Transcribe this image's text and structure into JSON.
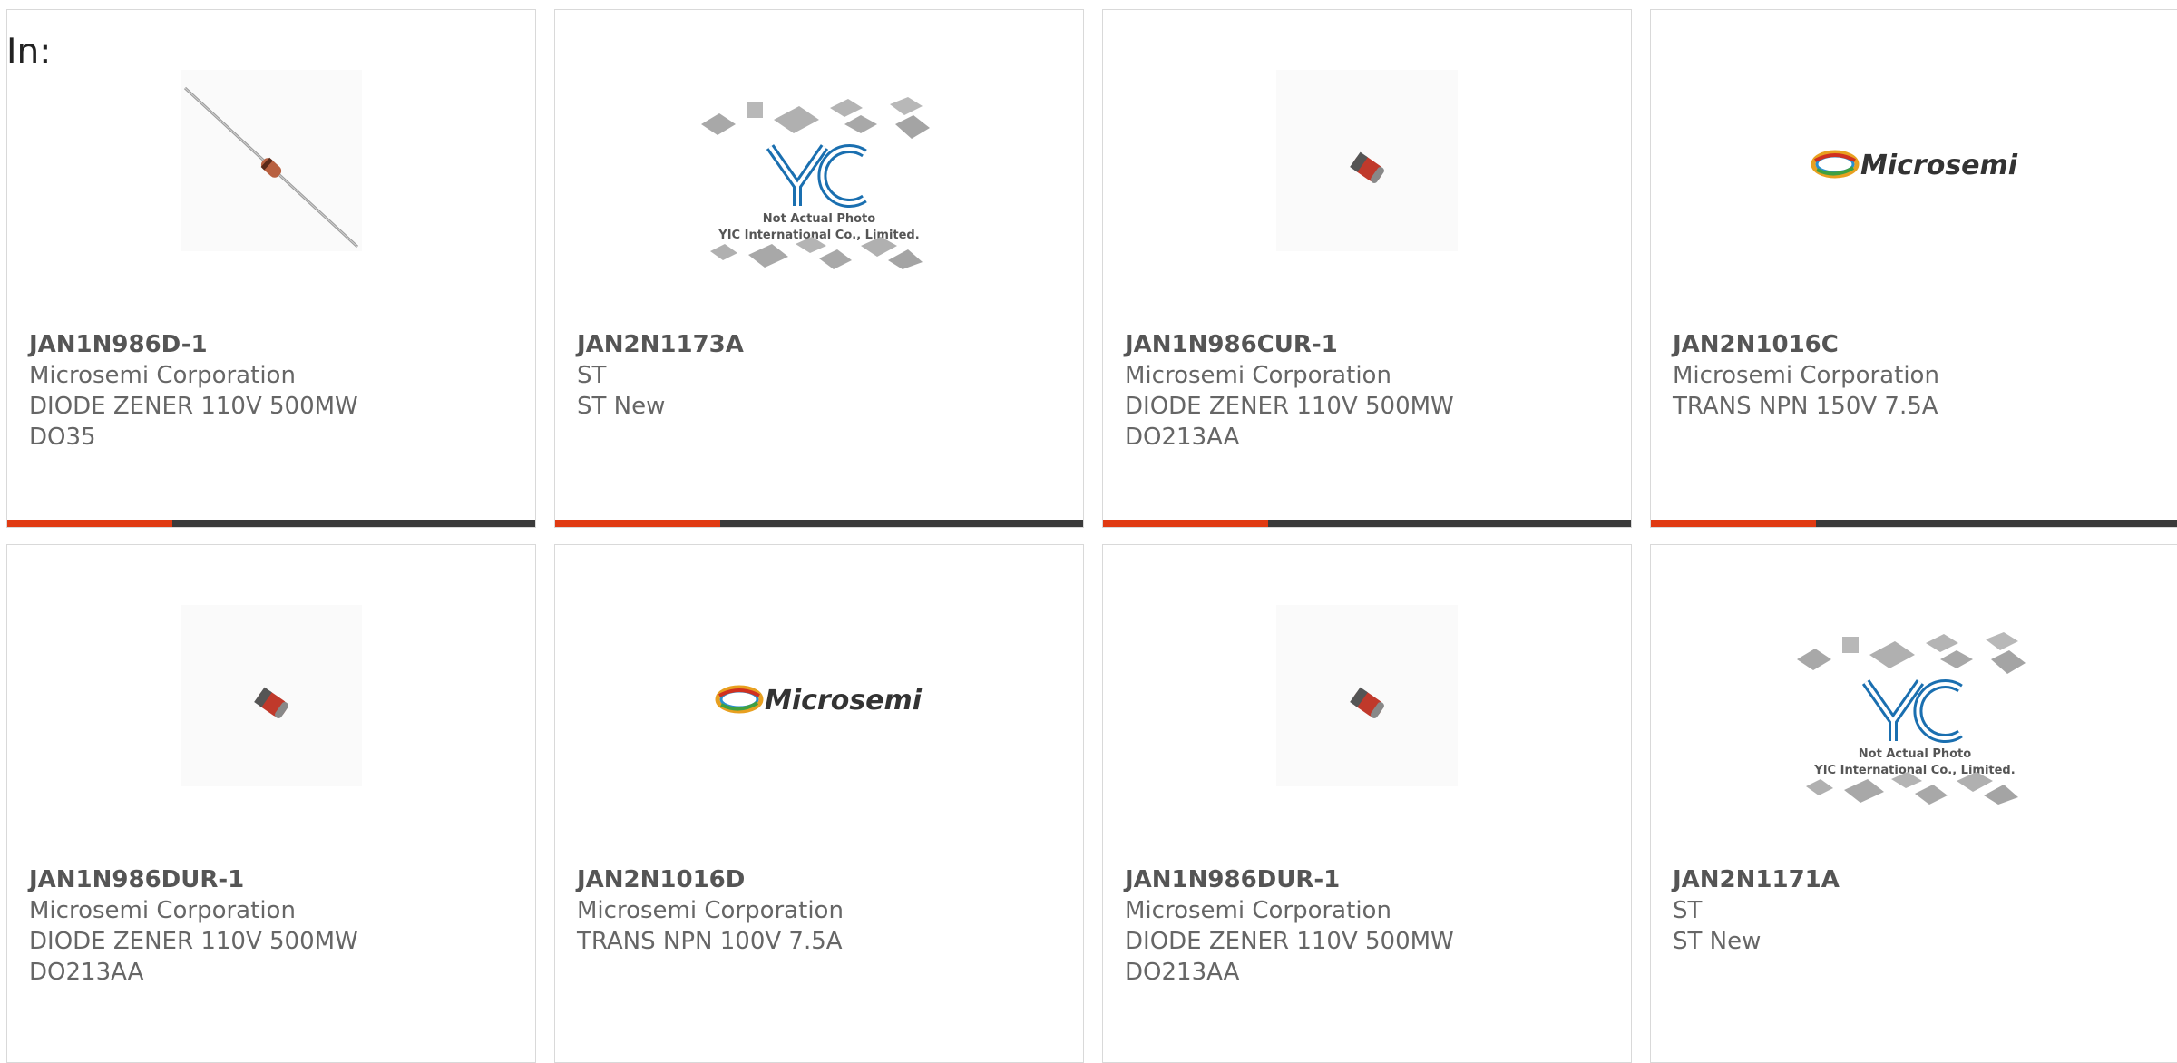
{
  "header": {
    "label": "In:"
  },
  "colors": {
    "accent": "#e03a12",
    "bar": "#3a3a3a",
    "border": "#d9d9d9"
  },
  "products": [
    {
      "part": "JAN1N986D-1",
      "mfr": "Microsemi Corporation",
      "desc": "DIODE ZENER 110V 500MW",
      "pkg": "DO35",
      "image": "axial-diode-icon"
    },
    {
      "part": "JAN2N1173A",
      "mfr": "ST",
      "desc": "ST New",
      "pkg": "",
      "image": "placeholder-photo-icon",
      "image_text": [
        "Not Actual Photo",
        "YIC International Co., Limited."
      ]
    },
    {
      "part": "JAN1N986CUR-1",
      "mfr": "Microsemi Corporation",
      "desc": "DIODE ZENER 110V 500MW",
      "pkg": "DO213AA",
      "image": "melf-diode-icon"
    },
    {
      "part": "JAN2N1016C",
      "mfr": "Microsemi Corporation",
      "desc": "TRANS NPN 150V 7.5A",
      "pkg": "",
      "image": "microsemi-logo",
      "logo_text": "Microsemi"
    },
    {
      "part": "JAN1N986DUR-1",
      "mfr": "Microsemi Corporation",
      "desc": "DIODE ZENER 110V 500MW",
      "pkg": "DO213AA",
      "image": "melf-diode-icon"
    },
    {
      "part": "JAN2N1016D",
      "mfr": "Microsemi Corporation",
      "desc": "TRANS NPN 100V 7.5A",
      "pkg": "",
      "image": "microsemi-logo",
      "logo_text": "Microsemi"
    },
    {
      "part": "JAN1N986DUR-1",
      "mfr": "Microsemi Corporation",
      "desc": "DIODE ZENER 110V 500MW",
      "pkg": "DO213AA",
      "image": "melf-diode-icon"
    },
    {
      "part": "JAN2N1171A",
      "mfr": "ST",
      "desc": "ST New",
      "pkg": "",
      "image": "placeholder-photo-icon",
      "image_text": [
        "Not Actual Photo",
        "YIC International Co., Limited."
      ]
    }
  ]
}
